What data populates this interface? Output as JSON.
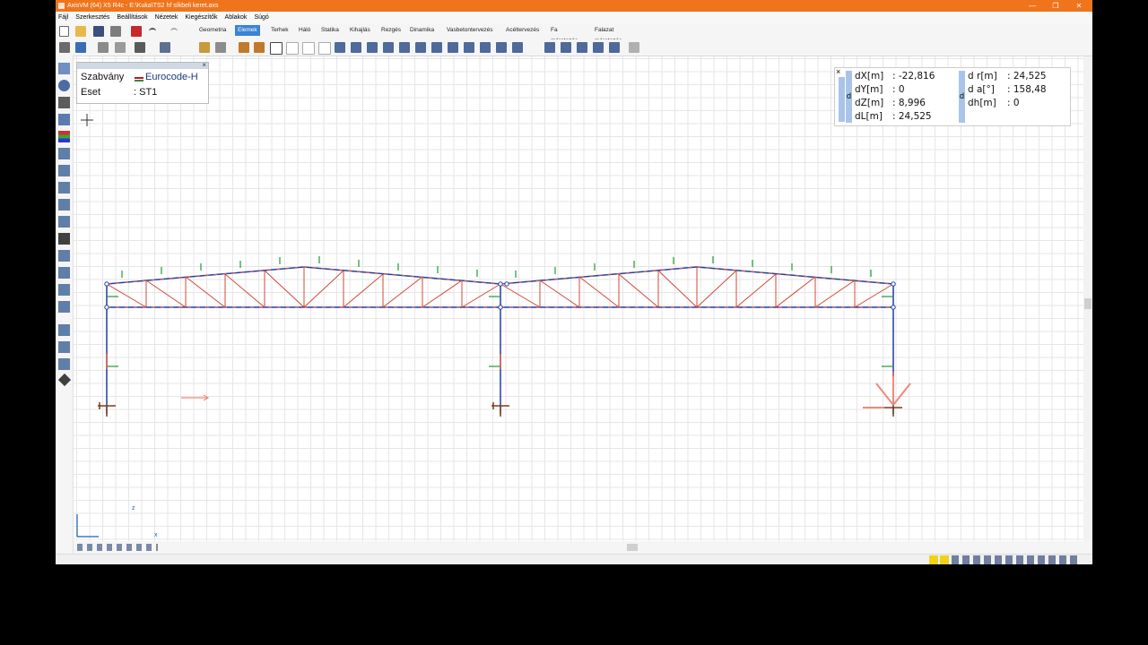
{
  "window": {
    "title": "AxisVM (64) X5 R4c - E:\\Kuka\\TS2 hf síkbeli keret.axs",
    "minimize_glyph": "—",
    "restore_glyph": "❐",
    "close_glyph": "✕"
  },
  "menu": [
    "Fájl",
    "Szerkesztés",
    "Beállítások",
    "Nézetek",
    "Kiegészítők",
    "Ablakok",
    "Súgó"
  ],
  "tabs": [
    {
      "label": "Geometria",
      "active": false
    },
    {
      "label": "Elemek",
      "active": true
    },
    {
      "label": "Terhek",
      "active": false
    },
    {
      "label": "Háló",
      "active": false
    },
    {
      "label": "Statika",
      "active": false
    },
    {
      "label": "Kihajlás",
      "active": false
    },
    {
      "label": "Rezgés",
      "active": false
    },
    {
      "label": "Dinamika",
      "active": false
    },
    {
      "label": "Vasbetontervezés",
      "active": false
    },
    {
      "label": "Acéltervezés",
      "active": false
    },
    {
      "label": "Fa méretezés",
      "active": false
    },
    {
      "label": "Falazat méretezés",
      "active": false
    }
  ],
  "info_panel": {
    "standard_label": "Szabvány",
    "standard_value": "Eurocode-H",
    "case_label": "Eset",
    "case_value": ": ST1",
    "close_glyph": "×"
  },
  "measure": {
    "close_glyph": "×",
    "strip_letter": "d",
    "left": [
      {
        "label": "dX[m]",
        "value": ": -22,816"
      },
      {
        "label": "dY[m]",
        "value": ": 0"
      },
      {
        "label": "dZ[m]",
        "value": ": 8,996"
      },
      {
        "label": "dL[m]",
        "value": ": 24,525"
      }
    ],
    "right": [
      {
        "label": "d r[m]",
        "value": ": 24,525"
      },
      {
        "label": "d a[°]",
        "value": ": 158,48"
      },
      {
        "label": "dh[m]",
        "value": ": 0"
      }
    ]
  },
  "axes": {
    "z": "z",
    "x": "x"
  },
  "colors": {
    "title_bar": "#f0741c",
    "active_tab": "#3a83d6",
    "member_blue": "#1f3fa0",
    "member_red": "#e05a4a",
    "load_green": "#1f9a2e",
    "support_brown": "#7a3c1c"
  }
}
